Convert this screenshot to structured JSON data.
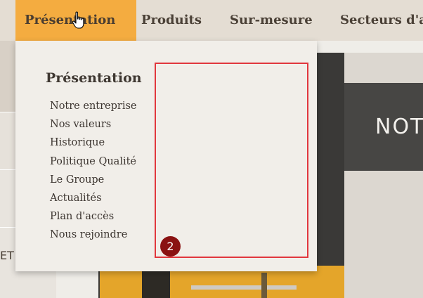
{
  "nav": {
    "items": [
      {
        "label": "Présentation"
      },
      {
        "label": "Produits"
      },
      {
        "label": "Sur-mesure"
      },
      {
        "label": "Secteurs d'ac"
      }
    ]
  },
  "dropdown": {
    "title": "Présentation",
    "links": [
      "Notre entreprise",
      "Nos valeurs",
      "Historique",
      "Politique Qualité",
      "Le Groupe",
      "Actualités",
      "Plan d'accès",
      "Nous rejoindre"
    ],
    "badge": "2"
  },
  "background": {
    "panel_heading": "NOT",
    "left_text": "ET"
  },
  "colors": {
    "active_tab": "#f4ac40",
    "annotation_border": "#e1373d",
    "badge": "#8a1212"
  },
  "icons": {
    "cursor": "hand-pointer-icon"
  }
}
